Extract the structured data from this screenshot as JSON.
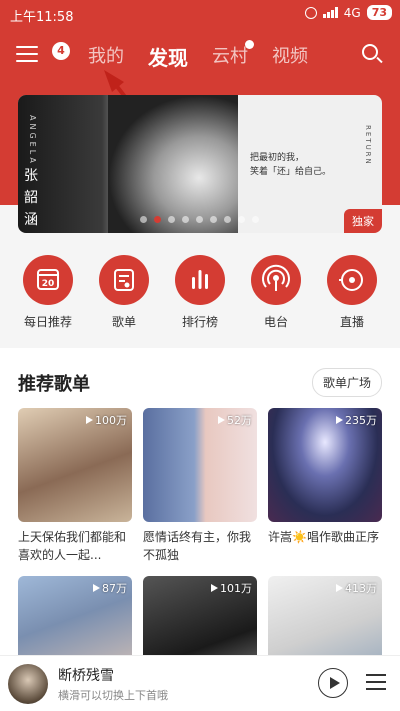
{
  "status_bar": {
    "time": "上午11:58",
    "network": "4G",
    "battery": "73"
  },
  "nav": {
    "menu_badge": "4",
    "tabs": [
      {
        "label": "我的"
      },
      {
        "label": "发现"
      },
      {
        "label": "云村"
      },
      {
        "label": "视频"
      }
    ],
    "active_tab": "发现"
  },
  "banner": {
    "artist_en": "ANGELA",
    "artist_cn": "张韶涵",
    "quote_line1": "把最初的我，",
    "quote_line2": "笑着「还」给自己。",
    "side_text": "RETURN",
    "tag": "独家",
    "dot_count": 9,
    "active_dot": 1
  },
  "quick_entries": [
    {
      "label": "每日推荐",
      "icon": "calendar-icon",
      "icon_text": "20"
    },
    {
      "label": "歌单",
      "icon": "playlist-icon"
    },
    {
      "label": "排行榜",
      "icon": "chart-bars-icon"
    },
    {
      "label": "电台",
      "icon": "radio-icon"
    },
    {
      "label": "直播",
      "icon": "live-icon"
    }
  ],
  "section": {
    "title": "推荐歌单",
    "more_label": "歌单广场"
  },
  "playlists": [
    {
      "plays": "100万",
      "title": "上天保佑我们都能和喜欢的人一起...",
      "color": "#c9b49a"
    },
    {
      "plays": "52万",
      "title": "愿情话终有主，你我不孤独",
      "color": "#8aa0c8"
    },
    {
      "plays": "235万",
      "title": "许嵩☀️唱作歌曲正序",
      "color": "#3a3f6e"
    },
    {
      "plays": "87万",
      "title": "",
      "color": "#7a8fb0"
    },
    {
      "plays": "101万",
      "title": "",
      "color": "#2b2b2b"
    },
    {
      "plays": "413万",
      "title": "",
      "color": "#d8d8d8"
    }
  ],
  "player": {
    "title": "断桥残雪",
    "subtitle": "横滑可以切换上下首哦"
  },
  "colors": {
    "brand": "#d43c33"
  }
}
